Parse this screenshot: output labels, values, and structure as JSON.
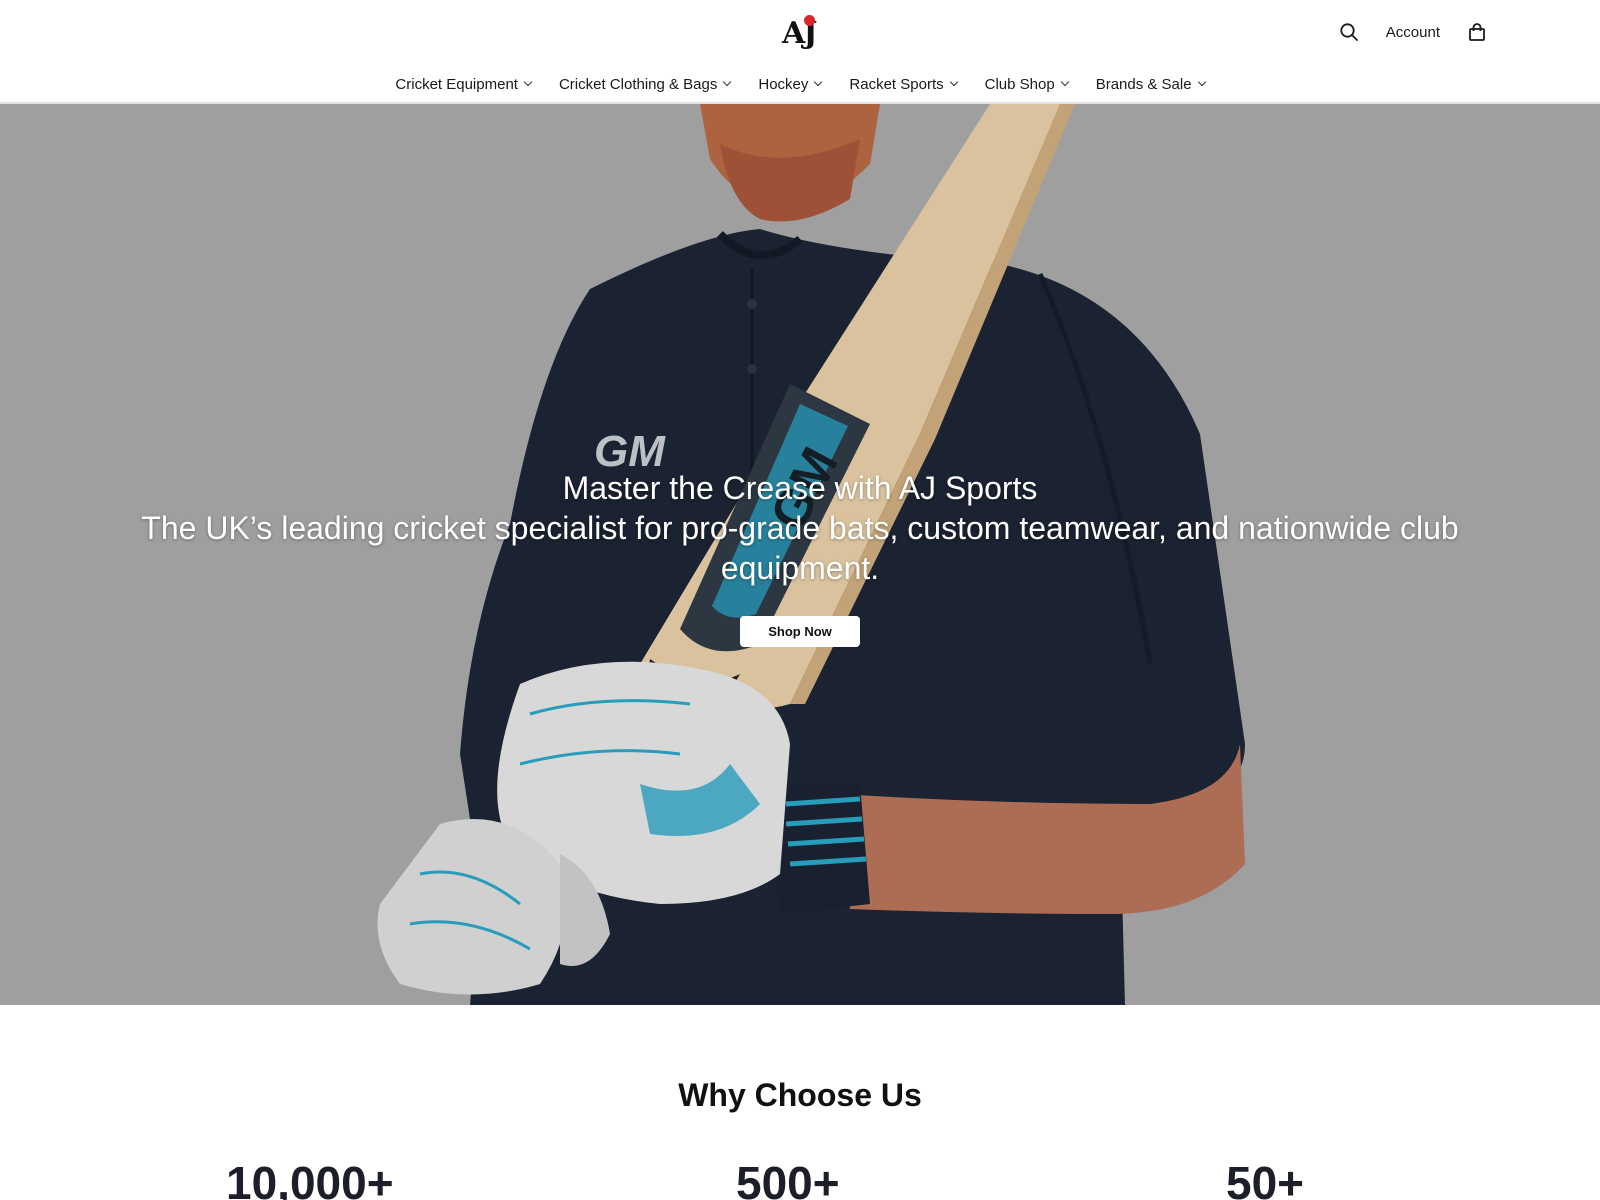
{
  "header": {
    "logo_text": "AJ",
    "account_label": "Account",
    "icons": {
      "search": "search-icon",
      "cart": "bag-icon"
    }
  },
  "nav": {
    "items": [
      {
        "label": "Cricket Equipment"
      },
      {
        "label": "Cricket Clothing & Bags"
      },
      {
        "label": "Hockey"
      },
      {
        "label": "Racket Sports"
      },
      {
        "label": "Club Shop"
      },
      {
        "label": "Brands & Sale"
      }
    ]
  },
  "hero": {
    "title": "Master the Crease with AJ Sports",
    "subtitle": "The UK’s leading cricket specialist for pro-grade bats, custom teamwear, and nationwide club equipment.",
    "cta_label": "Shop Now",
    "bat_logo": "GM",
    "shirt_logo": "GM"
  },
  "why": {
    "title": "Why Choose Us",
    "stats": [
      {
        "value": "10,000+"
      },
      {
        "value": "500+"
      },
      {
        "value": "50+"
      }
    ]
  },
  "colors": {
    "hero_bg": "#a9a9a9",
    "shirt": "#1d2535",
    "bat": "#e8cfa8",
    "accent_blue": "#2aa6c7",
    "logo_red": "#d8262c"
  }
}
